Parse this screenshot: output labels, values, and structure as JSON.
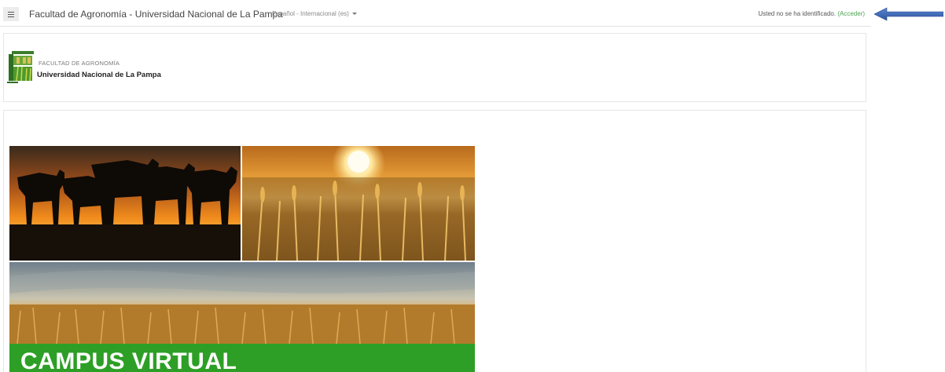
{
  "navbar": {
    "menu_icon": "hamburger-icon",
    "site_name": "Facultad de Agronomía - Universidad Nacional de La Pampa",
    "language": "Español - Internacional (es)",
    "login_status": "Usted no se ha identificado.",
    "login_link": "(Acceder)"
  },
  "header": {
    "logo_small_text": "FACULTAD DE AGRONOMÍA",
    "logo_big_text": "Universidad Nacional de La Pampa"
  },
  "banner": {
    "title": "CAMPUS VIRTUAL",
    "band_color": "#2d9f26"
  },
  "colors": {
    "link_green": "#4aa552",
    "arrow_blue": "#3b67b5"
  }
}
